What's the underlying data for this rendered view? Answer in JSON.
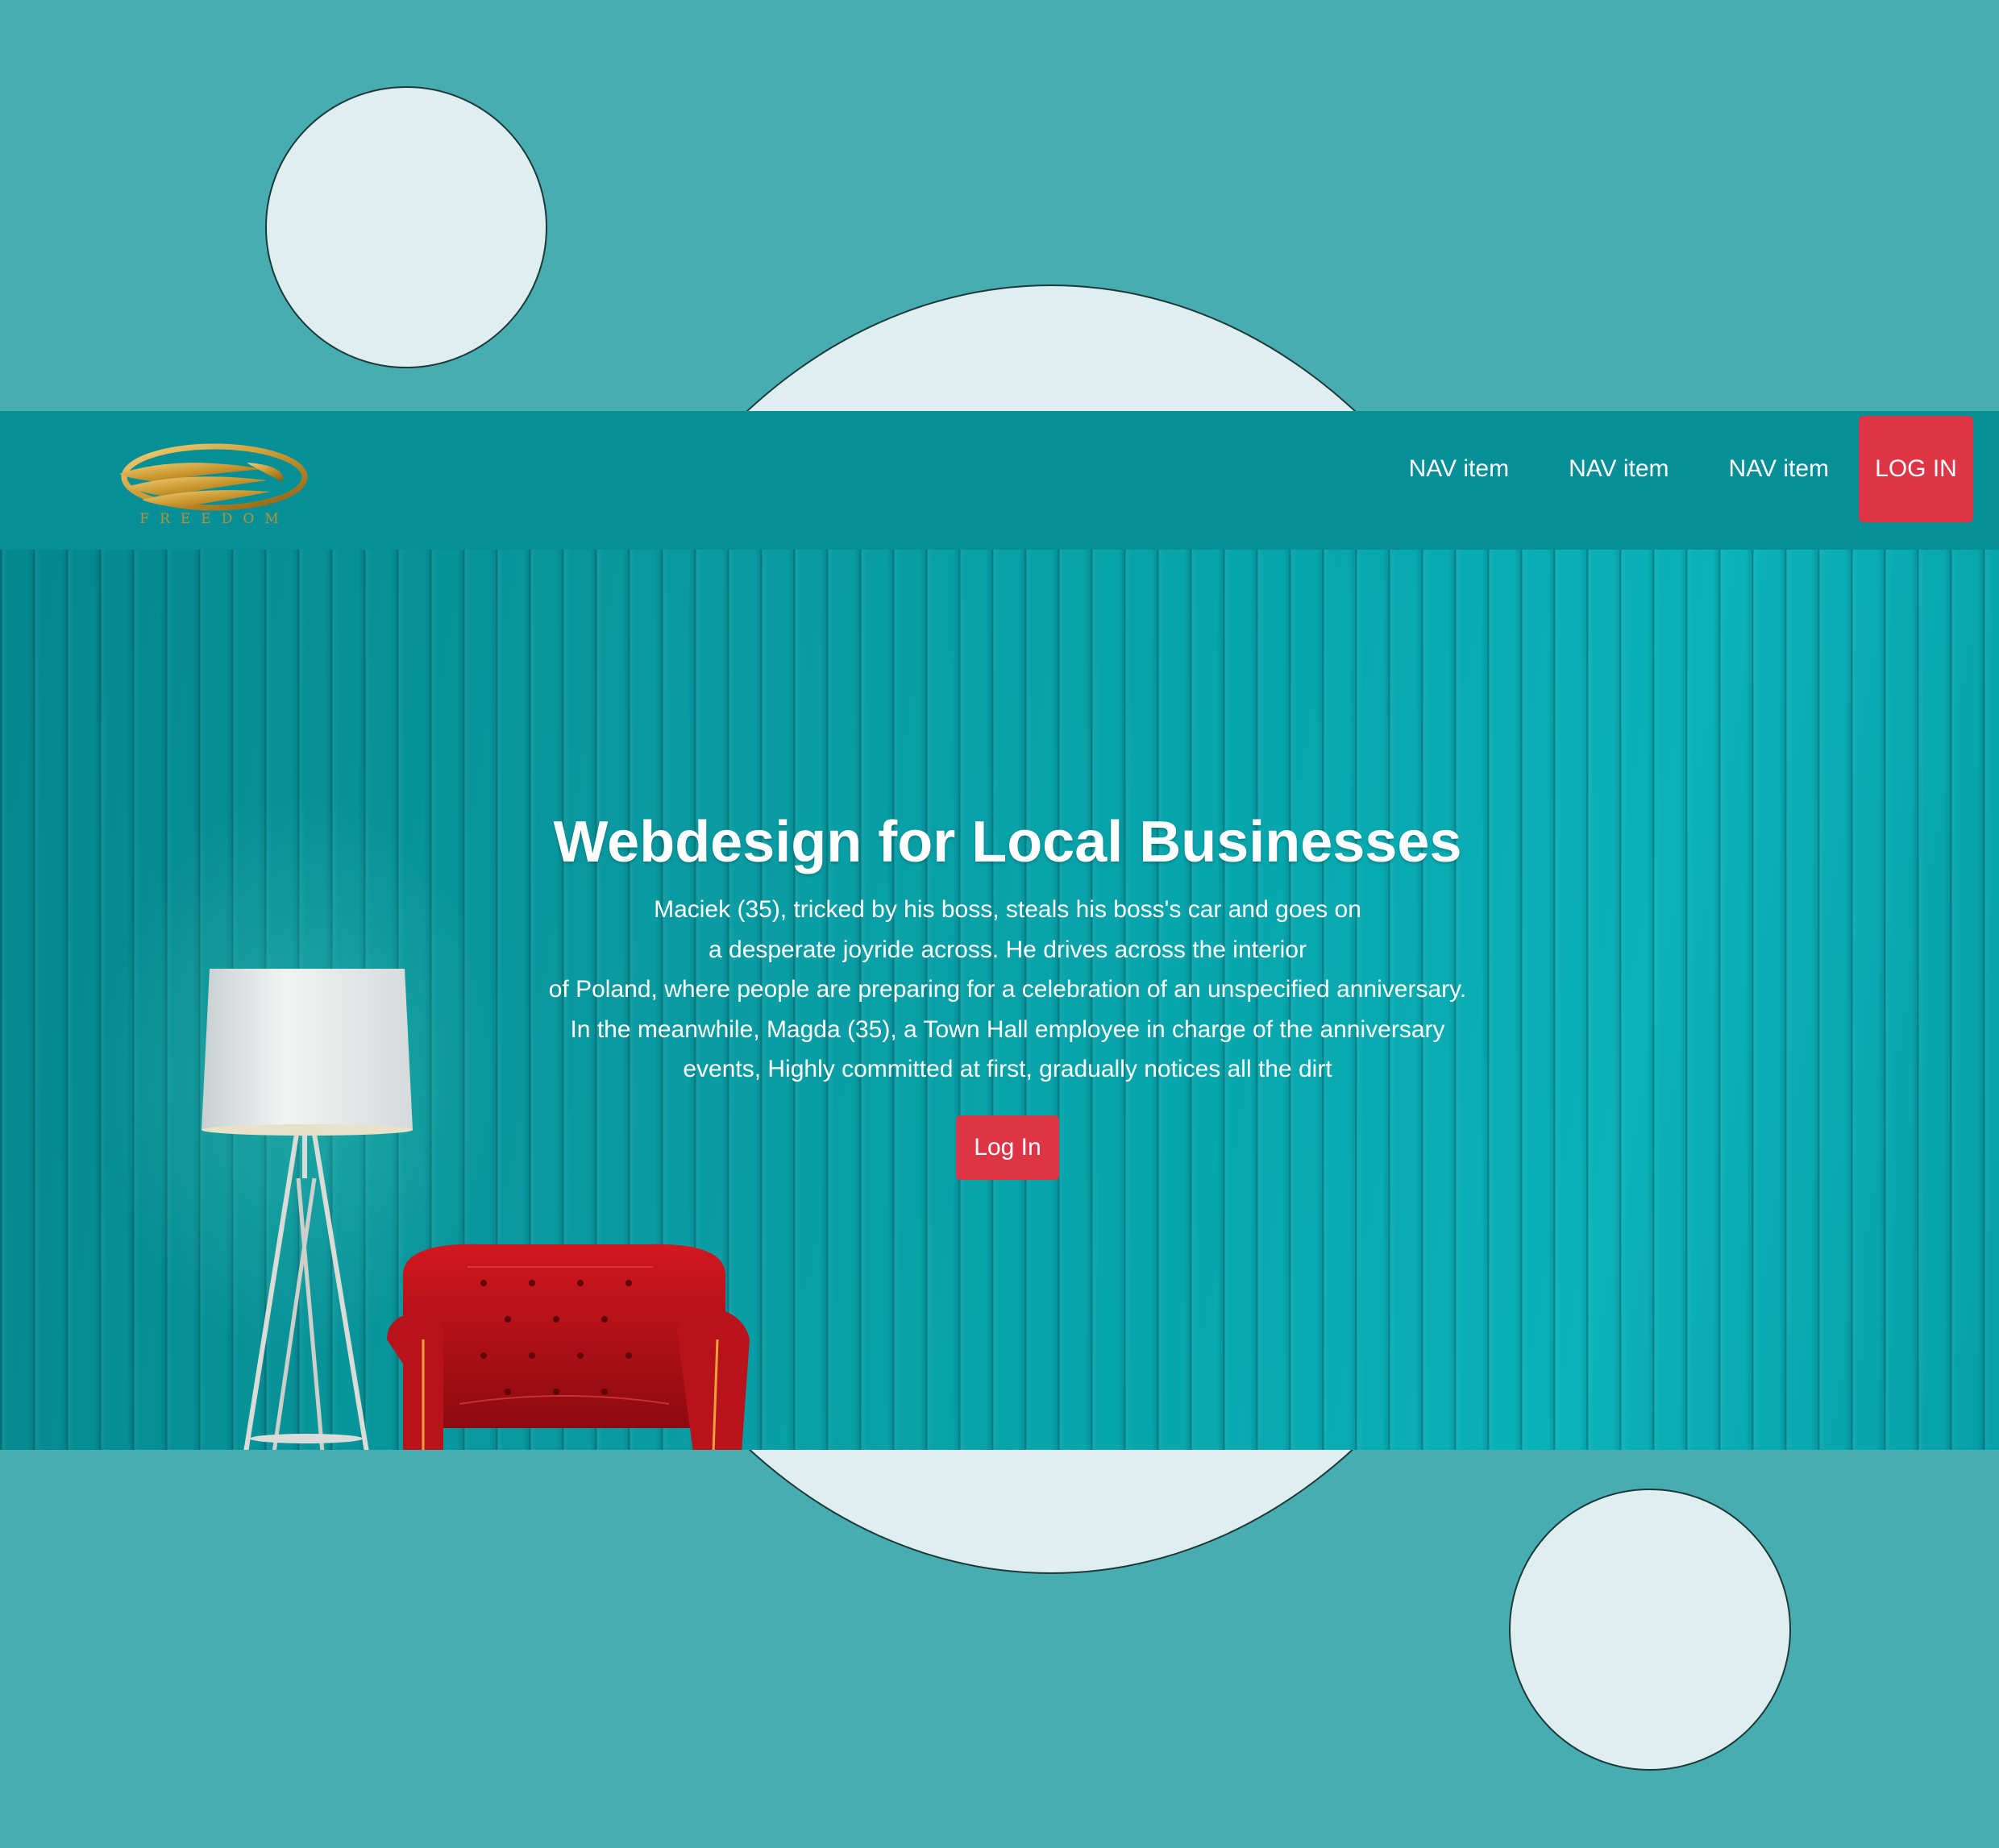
{
  "brand": {
    "logo_text": "FREEDOM"
  },
  "nav": {
    "items": [
      {
        "label": "NAV item"
      },
      {
        "label": "NAV item"
      },
      {
        "label": "NAV item"
      }
    ],
    "login_label": "LOG IN"
  },
  "hero": {
    "title": "Webdesign for Local Businesses",
    "description_lines": [
      "Maciek (35), tricked by his boss, steals his boss's car and goes on",
      "a desperate joyride across. He drives across the interior",
      "of Poland, where people are preparing for a celebration of an unspecified anniversary.",
      "In the meanwhile, Magda (35), a Town Hall employee in charge of the anniversary",
      "events, Highly committed at first, gradually notices all the dirt"
    ],
    "button_label": "Log In"
  },
  "colors": {
    "page_background": "#47adb0",
    "navbar": "#078f97",
    "accent_button": "#dd3446",
    "circle_fill": "#dfeeee",
    "logo_gold": "#c9a23f"
  },
  "icons": {
    "logo": "freedom-wing-logo-icon",
    "lamp": "floor-lamp-image",
    "chair": "red-armchair-image"
  }
}
